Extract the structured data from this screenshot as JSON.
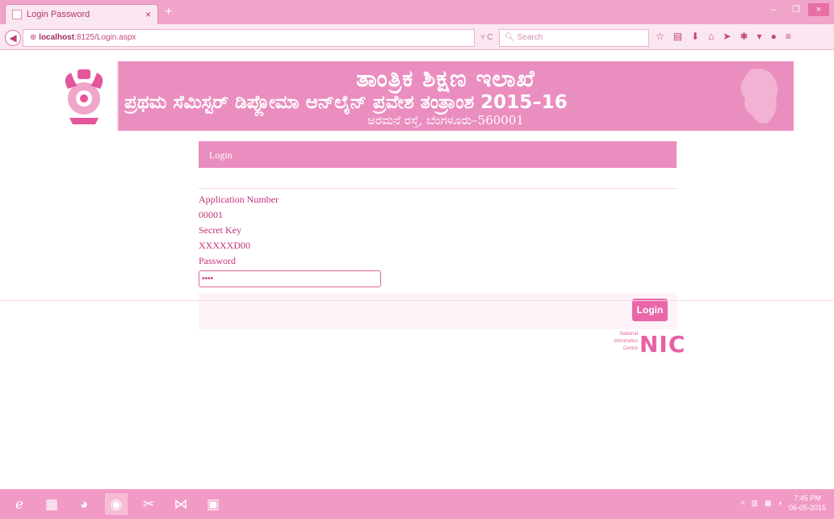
{
  "browser": {
    "tab_title": "Login Password",
    "tab_close": "×",
    "new_tab": "+",
    "url_host": "localhost",
    "url_rest": ":8125/Login.aspx",
    "search_placeholder": "Search",
    "reload_label": "▿ C",
    "window_controls": [
      "–",
      "❐",
      "×"
    ]
  },
  "banner": {
    "line1": "ತಾಂತ್ರಿಕ ಶಿಕ್ಷಣ ಇಲಾಖೆ",
    "line2": "ಪ್ರಥಮ ಸೆಮಿಸ್ಟರ್ ಡಿಪ್ಲೋಮಾ ಆನ್‌ಲೈನ್ ಪ್ರವೇಶ ತಂತ್ರಾಂಶ 2015–16",
    "line3": "ಅರಮನೆ ರಸ್ತೆ, ಬೆಂಗಳೂರು–560001"
  },
  "login": {
    "header": "Login",
    "application_label": "Application Number",
    "application_value": "00001",
    "secret_label": "Secret Key",
    "secret_value": "XXXXXD00",
    "password_label": "Password",
    "password_value": "••••",
    "button_label": "Login"
  },
  "nic": {
    "line1": "National",
    "line2": "Informatics",
    "line3": "Centre",
    "logo": "NIC"
  },
  "taskbar": {
    "time": "7:45 PM",
    "date": "06-05-2015"
  },
  "colors": {
    "accent": "#ea8ec0",
    "button": "#e967a9",
    "text": "#c72f78"
  }
}
